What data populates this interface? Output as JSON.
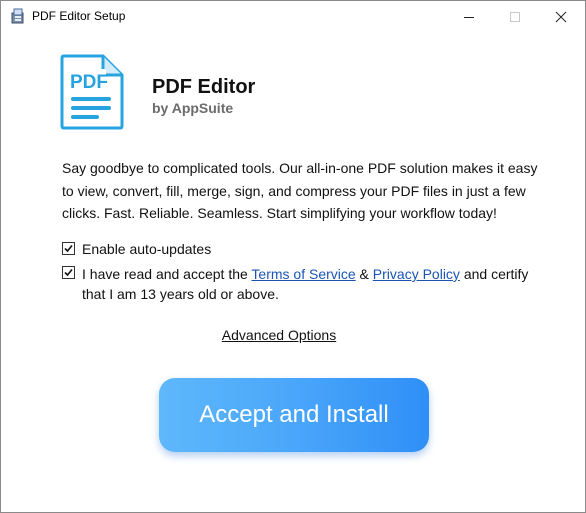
{
  "window": {
    "title": "PDF Editor Setup"
  },
  "icons": {
    "app": "installer-icon",
    "minimize": "minimize-icon",
    "maximize": "maximize-icon",
    "close": "close-icon",
    "logo": "pdf-document-icon"
  },
  "logo": {
    "text": "PDF"
  },
  "header": {
    "product_name": "PDF Editor",
    "vendor": "by AppSuite"
  },
  "description": "Say goodbye to complicated tools. Our all-in-one PDF solution makes it easy to view, convert, fill, merge, sign, and compress your PDF files in just a few clicks. Fast. Reliable. Seamless. Start simplifying your workflow today!",
  "options": {
    "auto_updates": {
      "label": "Enable auto-updates",
      "checked": true
    },
    "terms": {
      "prefix": "I have read and accept the ",
      "terms_link": "Terms of Service",
      "separator": " & ",
      "privacy_link": "Privacy Policy",
      "suffix": " and certify that I am 13 years old or above.",
      "checked": true
    }
  },
  "advanced_options": "Advanced Options",
  "install_button": {
    "label": "Accept and Install"
  },
  "colors": {
    "accent": "#2f8ff6",
    "logo_blue": "#27a3e0",
    "link": "#1a55b5"
  }
}
